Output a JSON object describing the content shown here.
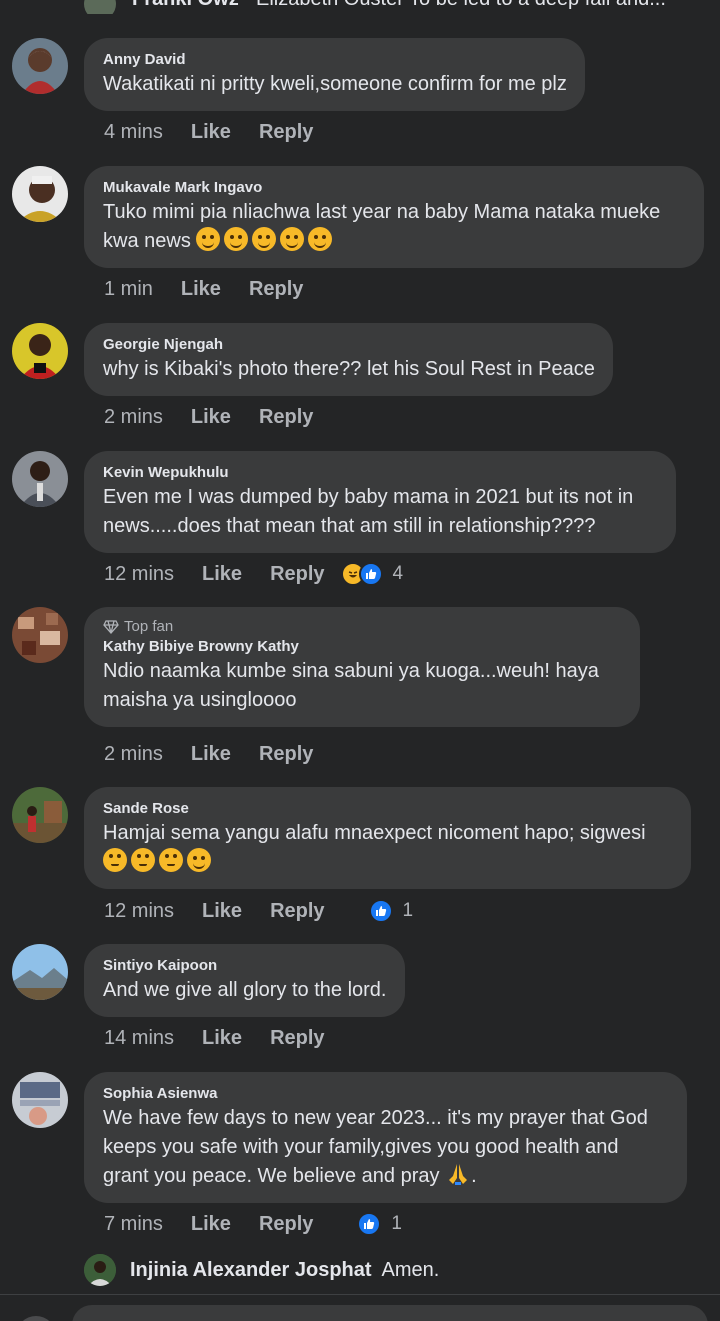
{
  "partial_top": {
    "author": "Franki Owz",
    "text": "Elizabeth Ouster  To be led to a deep fall and..."
  },
  "comments": [
    {
      "author": "Anny David",
      "text": "Wakatikati ni pritty kweli,someone confirm for me plz",
      "time": "4 mins",
      "like": "Like",
      "reply": "Reply"
    },
    {
      "author": "Mukavale Mark Ingavo",
      "text": "Tuko mimi pia nliachwa last year na baby Mama nataka mueke kwa news",
      "emoji": [
        "rofl-emoji",
        "rofl-emoji",
        "rofl-emoji",
        "rofl-emoji",
        "rofl-emoji"
      ],
      "time": "1 min",
      "like": "Like",
      "reply": "Reply"
    },
    {
      "author": "Georgie Njengah",
      "text": "why is Kibaki's photo there?? let his Soul Rest in Peace",
      "time": "2 mins",
      "like": "Like",
      "reply": "Reply"
    },
    {
      "author": "Kevin Wepukhulu",
      "text": "Even me I was dumped by baby mama in 2021 but its not in news.....does that mean that am still in relationship????",
      "time": "12 mins",
      "like": "Like",
      "reply": "Reply",
      "reaction_count": "4"
    },
    {
      "badge": "Top fan",
      "author": "Kathy Bibiye Browny Kathy",
      "text": "Ndio naamka kumbe sina sabuni ya kuoga...weuh! haya maisha ya usingloooo",
      "time": "2 mins",
      "like": "Like",
      "reply": "Reply"
    },
    {
      "author": "Sande Rose",
      "text": "Hamjai sema yangu alafu mnaexpect nicoment hapo; sigwesi",
      "time": "12 mins",
      "like": "Like",
      "reply": "Reply",
      "reaction_count": "1"
    },
    {
      "author": "Sintiyo Kaipoon",
      "text": "And we give all glory to the lord.",
      "time": "14 mins",
      "like": "Like",
      "reply": "Reply"
    },
    {
      "author": "Sophia Asienwa",
      "text": "We have few days to new year 2023... it's my prayer that God keeps you safe with your family,gives you good health and grant you peace. We believe and pray",
      "text_end": ".",
      "time": "7 mins",
      "like": "Like",
      "reply": "Reply",
      "reaction_count": "1"
    }
  ],
  "nested_reply": {
    "author": "Injinia Alexander Josphat",
    "text": "Amen."
  },
  "colors": {
    "background": "#242526",
    "bubble": "#3a3b3c",
    "text": "#e4e6eb",
    "muted": "#b0b3b8",
    "like_blue": "#1877f2",
    "haha_yellow": "#f7b928"
  }
}
